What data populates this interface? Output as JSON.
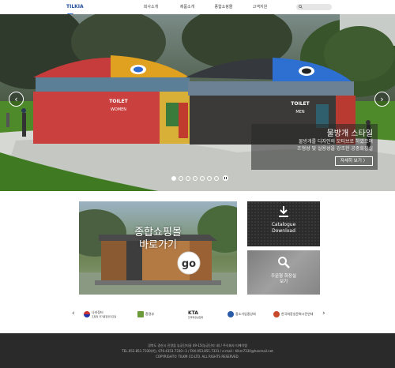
{
  "header": {
    "logo_text": "TILKIA",
    "nav": [
      "회사소개",
      "제품소개",
      "종합쇼핑몰",
      "고객지원"
    ],
    "search_placeholder": ""
  },
  "hero": {
    "left_booth_brand": "TOILET",
    "left_booth_sub": "WOMEN",
    "right_booth_brand": "TOILET",
    "right_booth_sub": "MEN",
    "caption_title": "물방개 스타일",
    "caption_desc_1": "물방개를 디자인의 모티브로 하였으며",
    "caption_desc_2": "조형성 및 실용성을 강조한 공중화장실",
    "more_label": "자세히 보기 〉",
    "slide_count": 7,
    "active_slide": 1
  },
  "mall_banner": {
    "line1": "종합쇼핑몰",
    "line2": "바로가기",
    "badge": "go"
  },
  "catalogue": {
    "line1": "Catalogue",
    "line2": "Download"
  },
  "order": {
    "line1": "주문형 화장실",
    "line2": "보기"
  },
  "partners": [
    {
      "name": "나라장터",
      "sub": "조달청 국가종합전자조달"
    },
    {
      "name": "환경부",
      "sub": ""
    },
    {
      "name": "KTA",
      "sub": "한국화장실협회"
    },
    {
      "name": "중소기업중앙회",
      "sub": ""
    },
    {
      "name": "한국화장실문화시민연대",
      "sub": ""
    }
  ],
  "footer": {
    "line1": "경북도 경산시 진량읍 농공단지길 49-15(농공단지 내)  /  주식회사 티에이엠",
    "line2": "TEL.053.851.7330(代), 070.4353.7330~3  /  FAX.053.851.7331  /  e-mail : tilkm7330@hanmail.net",
    "line3": "COPYRIGHT© TILKM CO.LTD. ALL RIGHTS RESERVED."
  }
}
